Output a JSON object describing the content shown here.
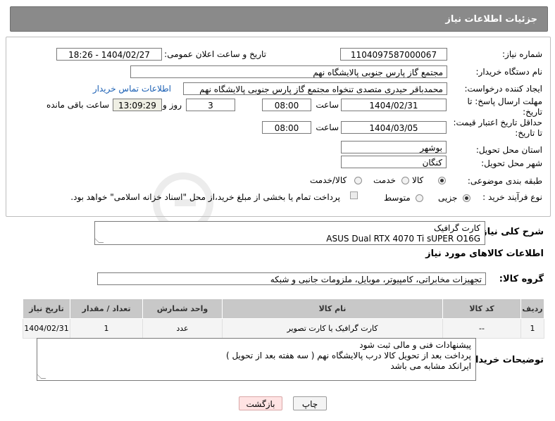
{
  "header": {
    "title": "جزئیات اطلاعات نیاز"
  },
  "watermark": {
    "text": "AriaTender.neT"
  },
  "form": {
    "need_number": {
      "label": "شماره نیاز:",
      "value": "1104097587000067"
    },
    "announce": {
      "label": "تاریخ و ساعت اعلان عمومی:",
      "value": "1404/02/27 - 18:26"
    },
    "buyer_org": {
      "label": "نام دستگاه خریدار:",
      "value": "مجتمع گاز پارس جنوبی  پالایشگاه نهم"
    },
    "requester": {
      "label": "ایجاد کننده درخواست:",
      "value": "محمدباقر حیدری متصدی تنخواه مجتمع گاز پارس جنوبی  پالایشگاه نهم",
      "contact_link": "اطلاعات تماس خریدار"
    },
    "reply_deadline": {
      "label1": "مهلت ارسال پاسخ: تا",
      "label2": "تاریخ:",
      "date": "1404/02/31",
      "time_label": "ساعت",
      "time": "08:00",
      "days": "3",
      "days_label": "روز و",
      "remaining": "13:09:29",
      "remaining_label": "ساعت باقی مانده"
    },
    "price_validity": {
      "label1": "حداقل تاریخ اعتبار قیمت:",
      "label2": "تا تاریخ:",
      "date": "1404/03/05",
      "time_label": "ساعت",
      "time": "08:00"
    },
    "province": {
      "label": "استان محل تحویل:",
      "value": "بوشهر"
    },
    "city": {
      "label": "شهر محل تحویل:",
      "value": "کنگان"
    },
    "category": {
      "label": "طبقه بندی موضوعی:",
      "options": [
        "کالا",
        "خدمت",
        "کالا/خدمت"
      ],
      "selected": "کالا"
    },
    "process": {
      "label": "نوع فرآیند خرید :",
      "options": [
        "جزیی",
        "متوسط"
      ],
      "selected": "جزیی",
      "note": "پرداخت تمام یا بخشی از مبلغ خرید،از محل \"اسناد خزانه اسلامی\" خواهد بود."
    }
  },
  "description": {
    "label": "شرح کلی نیاز:",
    "line1": "کارت گرافیک",
    "line2": "ASUS Dual RTX 4070 Ti sUPER O16G"
  },
  "goods_info": {
    "title": "اطلاعات کالاهای مورد نیاز",
    "group_label": "گروه کالا:",
    "group_value": "تجهیزات مخابراتی، کامپیوتر، موبایل، ملزومات جانبی و شبکه"
  },
  "table": {
    "headers": {
      "row": "ردیف",
      "code": "کد کالا",
      "name": "نام کالا",
      "unit": "واحد شمارش",
      "qty": "تعداد / مقدار",
      "date": "تاریخ نیاز"
    },
    "rows": [
      {
        "row": "1",
        "code": "--",
        "name": "کارت گرافیک یا کارت تصویر",
        "unit": "عدد",
        "qty": "1",
        "date": "1404/02/31"
      }
    ]
  },
  "buyer_notes": {
    "label": "توضیحات خریدار:",
    "line1": "پیشنهادات فنی و مالی ثبت شود",
    "line2": "پرداخت بعد از تحویل کالا درب پالایشگاه نهم ( سه هفته بعد از تحویل )",
    "line3": "ایرانکد مشابه می باشد"
  },
  "buttons": {
    "print": "چاپ",
    "back": "بازگشت"
  }
}
